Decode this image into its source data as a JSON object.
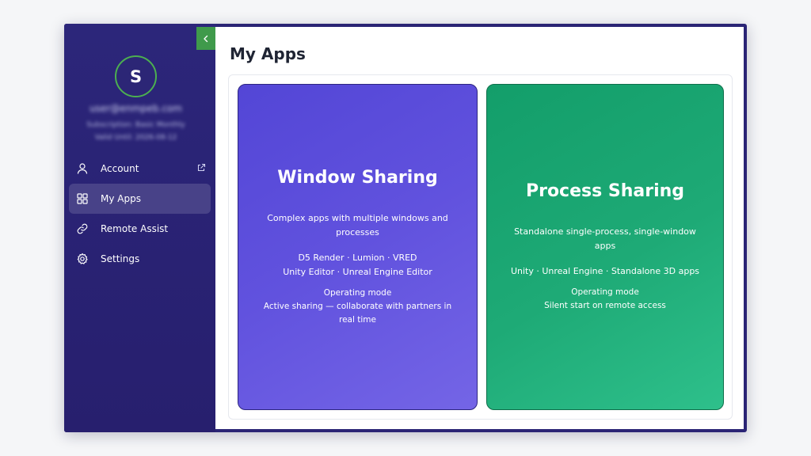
{
  "sidebar": {
    "avatar_initial": "S",
    "user_email": "user@enmpeb.com",
    "subscription": "Subscription: Basic Monthly",
    "valid_until": "Valid Until: 2026-08-12",
    "items": [
      {
        "label": "Account",
        "icon": "user-icon",
        "external": true
      },
      {
        "label": "My Apps",
        "icon": "grid-icon",
        "active": true
      },
      {
        "label": "Remote Assist",
        "icon": "link-icon"
      },
      {
        "label": "Settings",
        "icon": "gear-icon"
      }
    ]
  },
  "main": {
    "title": "My Apps",
    "cards": [
      {
        "title": "Window Sharing",
        "description": "Complex apps with multiple windows and processes",
        "apps_line1": "D5 Render · Lumion · VRED",
        "apps_line2": "Unity Editor · Unreal Engine Editor",
        "mode_label": "Operating mode",
        "mode_value": "Active sharing — collaborate with partners in real time",
        "color": "#5b4de0"
      },
      {
        "title": "Process Sharing",
        "description": "Standalone single-process, single-window apps",
        "apps_line1": "Unity · Unreal Engine · Standalone 3D apps",
        "mode_label": "Operating mode",
        "mode_value": "Silent start on remote access",
        "color": "#1faa76"
      }
    ]
  },
  "colors": {
    "sidebar_bg": "#2a2475",
    "accent_green": "#4caf50",
    "collapse_button": "#3f9a4b"
  }
}
